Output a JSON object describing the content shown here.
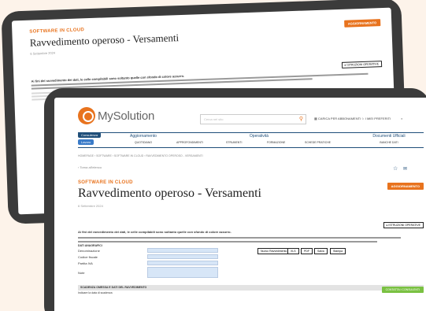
{
  "brand": {
    "software_label": "SOFTWARE IN CLOUD",
    "logo_text": "MySolution"
  },
  "page": {
    "title": "Ravvedimento operoso - Versamenti",
    "date": "6 Settembre 2024",
    "update_button": "AGGIORNAMENTO",
    "operative_button": "▸ ISTRUZIONI OPERATIVE",
    "intro_text": "Ai fini del ravvedimento dei dati, le celle compilabili sono soltanto quelle con sfondo di colore azzurro."
  },
  "header": {
    "search_placeholder": "Cerca nel sito",
    "cart_label": "CARICA PER ABBONAMENTI",
    "favorites_label": "I MIEI PREFERITI"
  },
  "nav": {
    "badge_1": "Consulenza",
    "badge_2": "Lavoro",
    "sections": [
      {
        "label": "Aggiornamento",
        "sub": "QUOTIDIANO"
      },
      {
        "label": "Operatività",
        "sub": ""
      },
      {
        "label": "Documenti Ufficiali",
        "sub": "BANCHE DATI"
      }
    ],
    "sub_items": [
      "APPROFONDIMENTI",
      "STRUMENTI",
      "FORMAZIONE",
      "SCHEDE PRATICHE"
    ]
  },
  "breadcrumb": "HOMEPAGE  ›  SOFTWARE  ›  SOFTWARE IN CLOUD  ›  RAVVEDIMENTO OPEROSO - VERSAMENTI",
  "back_link": "‹  Torna all'elenco",
  "form": {
    "section_title": "DATI ANAGRAFICI",
    "rows": [
      "Denominazione",
      "Codice fiscale",
      "Partita IVA",
      "Note"
    ],
    "tools": [
      "Nuovo Ravvedimento",
      "XLS",
      "PDF",
      "Salva",
      "Stampa"
    ],
    "section_bar": "SCADENZA OMESSA E DATI DEL RAVVEDIMENTO",
    "section_sub": "Indicare la data di scadenza",
    "contact_button": "CONTATTA I CONSULENTI"
  },
  "colors": {
    "accent": "#e8731e",
    "nav": "#1f4e79",
    "field": "#d7e6f7",
    "green": "#7ac142"
  }
}
